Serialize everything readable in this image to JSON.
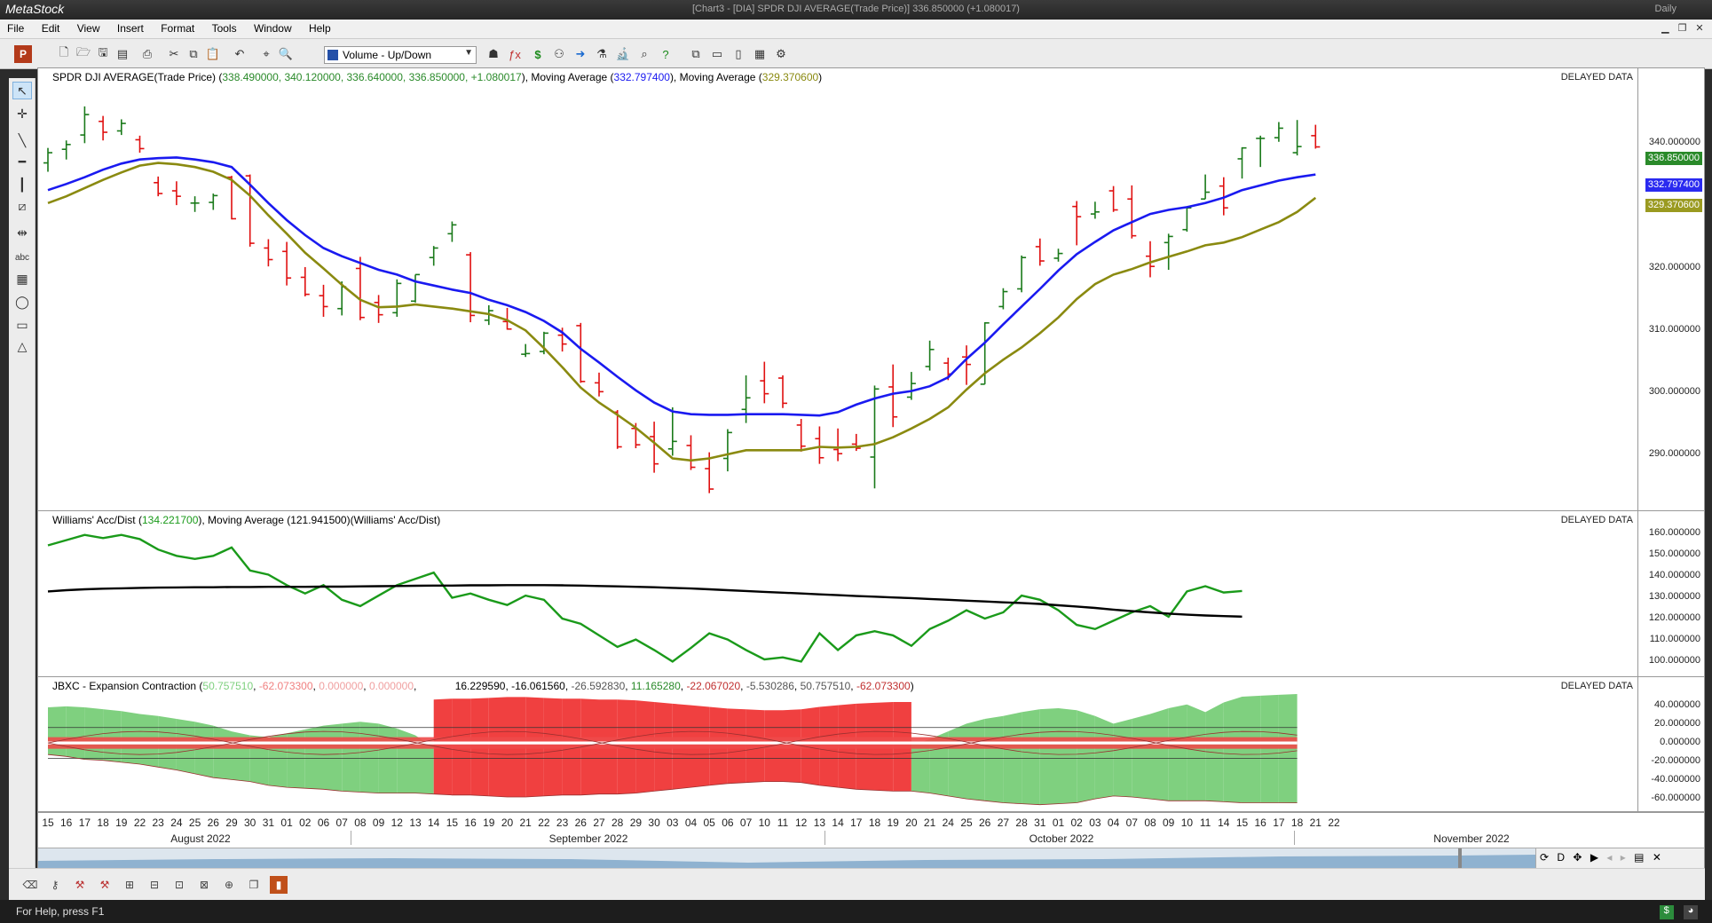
{
  "window": {
    "app_name": "MetaStock",
    "title": "[Chart3 - [DIA] SPDR DJI AVERAGE(Trade Price)]  336.850000 (+1.080017)",
    "periodicity": "Daily"
  },
  "menu": [
    "File",
    "Edit",
    "View",
    "Insert",
    "Format",
    "Tools",
    "Window",
    "Help"
  ],
  "toolbar": {
    "chart_style_select": "Volume - Up/Down"
  },
  "colors": {
    "up_bar": "#1a7a1a",
    "down_bar": "#e01010",
    "ma_fast": "#1a1af0",
    "ma_slow": "#8a8a10",
    "wad_line": "#1a9a1a",
    "wad_ma": "#000000",
    "expansion_fill": "#7fd07f",
    "contraction_fill": "#f04040"
  },
  "price_pane": {
    "title_prefix": "SPDR DJI AVERAGE(Trade Price) (",
    "ohlc": "338.490000, 340.120000, 336.640000, 336.850000, +1.080017",
    "title_mid1": "), Moving Average (",
    "ma1": "332.797400",
    "title_mid2": "), Moving Average (",
    "ma2": "329.370600",
    "title_suffix": ")",
    "delayed": "DELAYED DATA",
    "yticks": [
      "340.000000",
      "320.000000",
      "310.000000",
      "300.000000",
      "290.000000"
    ],
    "badge_close": "336.850000",
    "badge_ma1": "332.797400",
    "badge_ma2": "329.370600"
  },
  "wad_pane": {
    "title_prefix": "Williams' Acc/Dist (",
    "value": "134.221700",
    "title_mid": "), Moving Average (",
    "ma_value": "121.941500",
    "title_suffix": ")(Williams' Acc/Dist)",
    "delayed": "DELAYED DATA",
    "yticks": [
      "160.000000",
      "150.000000",
      "140.000000",
      "130.000000",
      "120.000000",
      "110.000000",
      "100.000000"
    ]
  },
  "jbxc_pane": {
    "title_prefix": "JBXC - Expansion Contraction (",
    "v1": "50.757510",
    "v2": "-62.073300",
    "v3": "0.000000",
    "v4": "0.000000",
    "v5": "16.229590",
    "v6": "-16.061560",
    "v7": "-26.592830",
    "v8": "11.165280",
    "v9": "-22.067020",
    "v10": "-5.530286",
    "v11": "50.757510",
    "v12": "-62.073300",
    "title_suffix": ")",
    "delayed": "DELAYED DATA",
    "yticks": [
      "40.000000",
      "20.000000",
      "0.000000",
      "-20.000000",
      "-40.000000",
      "-60.000000"
    ]
  },
  "xaxis": {
    "days": [
      "15",
      "16",
      "17",
      "18",
      "19",
      "22",
      "23",
      "24",
      "25",
      "26",
      "29",
      "30",
      "31",
      "01",
      "02",
      "06",
      "07",
      "08",
      "09",
      "12",
      "13",
      "14",
      "15",
      "16",
      "19",
      "20",
      "21",
      "22",
      "23",
      "26",
      "27",
      "28",
      "29",
      "30",
      "03",
      "04",
      "05",
      "06",
      "07",
      "10",
      "11",
      "12",
      "13",
      "14",
      "17",
      "18",
      "19",
      "20",
      "21",
      "24",
      "25",
      "26",
      "27",
      "28",
      "31",
      "01",
      "02",
      "03",
      "04",
      "07",
      "08",
      "09",
      "10",
      "11",
      "14",
      "15",
      "16",
      "17",
      "18",
      "21",
      "22"
    ],
    "months": [
      "August 2022",
      "September 2022",
      "October 2022",
      "November 2022"
    ]
  },
  "overview": {
    "periodicity_letter": "D"
  },
  "status": {
    "help": "For Help, press F1"
  },
  "chart_data": [
    {
      "type": "ohlc",
      "title": "SPDR DJI AVERAGE(Trade Price)",
      "ylim": [
        284,
        345
      ],
      "bars": [
        [
          334.5,
          336.7,
          333.2,
          336.0
        ],
        [
          336.5,
          337.8,
          335.0,
          337.2
        ],
        [
          338.6,
          342.8,
          337.4,
          341.6
        ],
        [
          340.6,
          341.4,
          337.8,
          339.0
        ],
        [
          339.2,
          340.9,
          338.6,
          340.3
        ],
        [
          337.9,
          338.5,
          336.0,
          336.6
        ],
        [
          331.6,
          332.5,
          329.6,
          330.0
        ],
        [
          330.4,
          331.8,
          328.3,
          329.6
        ],
        [
          328.6,
          329.6,
          327.3,
          328.6
        ],
        [
          328.7,
          330.0,
          327.6,
          329.7
        ],
        [
          332.4,
          332.6,
          326.2,
          326.3
        ],
        [
          332.6,
          332.8,
          322.2,
          322.7
        ],
        [
          322.0,
          323.3,
          319.3,
          320.3
        ],
        [
          321.5,
          322.9,
          316.5,
          317.6
        ],
        [
          317.7,
          319.2,
          314.9,
          315.2
        ],
        [
          315.0,
          316.6,
          311.9,
          313.4
        ],
        [
          313.1,
          317.1,
          312.1,
          316.3
        ],
        [
          319.0,
          320.7,
          311.4,
          311.8
        ],
        [
          314.0,
          315.1,
          311.0,
          312.2
        ],
        [
          312.5,
          317.4,
          311.9,
          316.8
        ],
        [
          314.2,
          318.1,
          314.0,
          318.1
        ],
        [
          320.6,
          322.3,
          319.4,
          322.0
        ],
        [
          324.1,
          325.9,
          322.9,
          325.4
        ],
        [
          321.0,
          321.4,
          311.1,
          312.1
        ],
        [
          311.4,
          313.6,
          310.7,
          312.8
        ],
        [
          311.2,
          313.2,
          310.0,
          310.1
        ],
        [
          306.4,
          307.9,
          306.0,
          306.5
        ],
        [
          306.8,
          309.7,
          306.4,
          309.5
        ],
        [
          309.2,
          310.3,
          306.8,
          307.9
        ],
        [
          310.6,
          311.0,
          302.2,
          302.4
        ],
        [
          302.2,
          303.7,
          300.2,
          300.9
        ],
        [
          297.9,
          298.2,
          292.5,
          292.8
        ],
        [
          295.5,
          296.3,
          292.6,
          293.1
        ],
        [
          294.3,
          296.5,
          289.0,
          290.3
        ],
        [
          292.5,
          298.6,
          291.5,
          293.6
        ],
        [
          293.0,
          294.5,
          289.4,
          289.8
        ],
        [
          289.6,
          292.0,
          286.0,
          286.6
        ],
        [
          291.1,
          295.4,
          289.2,
          294.9
        ],
        [
          298.3,
          303.3,
          296.3,
          300.0
        ],
        [
          302.5,
          305.3,
          299.2,
          300.6
        ],
        [
          302.9,
          303.3,
          298.5,
          299.2
        ],
        [
          296.0,
          296.9,
          292.1,
          292.9
        ],
        [
          294.0,
          295.8,
          290.3,
          291.2
        ],
        [
          292.4,
          295.5,
          290.7,
          291.8
        ],
        [
          293.2,
          294.7,
          292.2,
          292.6
        ],
        [
          291.3,
          301.8,
          286.7,
          301.3
        ],
        [
          301.6,
          304.9,
          295.7,
          297.2
        ],
        [
          300.1,
          303.8,
          299.7,
          302.1
        ],
        [
          304.6,
          308.4,
          304.0,
          307.1
        ],
        [
          305.1,
          305.9,
          302.6,
          303.5
        ],
        [
          306.0,
          307.7,
          301.9,
          304.9
        ],
        [
          302.0,
          311.1,
          302.0,
          311.0
        ],
        [
          313.4,
          316.1,
          313.0,
          315.6
        ],
        [
          316.0,
          320.9,
          315.5,
          320.6
        ],
        [
          322.2,
          323.4,
          319.4,
          320.1
        ],
        [
          320.5,
          321.9,
          320.0,
          321.2
        ],
        [
          328.1,
          328.9,
          322.4,
          326.6
        ],
        [
          327.0,
          328.8,
          326.3,
          327.3
        ],
        [
          330.4,
          331.1,
          327.3,
          327.6
        ],
        [
          329.2,
          331.2,
          323.4,
          323.8
        ],
        [
          320.8,
          323.0,
          317.7,
          319.3
        ],
        [
          322.8,
          324.1,
          318.8,
          323.7
        ],
        [
          324.7,
          328.1,
          324.4,
          327.9
        ],
        [
          329.2,
          332.8,
          329.2,
          330.2
        ],
        [
          331.1,
          332.4,
          326.8,
          327.9
        ],
        [
          335.1,
          336.8,
          332.2,
          336.7
        ],
        [
          338.1,
          338.5,
          333.9,
          338.1
        ],
        [
          338.2,
          340.5,
          337.6,
          339.6
        ],
        [
          336.0,
          340.8,
          335.6,
          336.9
        ],
        [
          338.5,
          340.1,
          336.6,
          336.85
        ]
      ],
      "ma1": [
        330.5,
        331.4,
        332.4,
        333.5,
        334.4,
        335.0,
        335.2,
        335.3,
        335.0,
        334.6,
        333.9,
        331.3,
        328.6,
        326.1,
        323.9,
        322.0,
        320.8,
        319.8,
        318.8,
        318.1,
        317.1,
        316.5,
        315.9,
        315.4,
        314.4,
        313.6,
        312.6,
        311.3,
        309.6,
        307.2,
        305.2,
        303.1,
        301.1,
        299.3,
        298.0,
        297.6,
        297.5,
        297.5,
        297.6,
        297.6,
        297.6,
        297.5,
        297.4,
        297.9,
        299.0,
        299.9,
        300.6,
        301.0,
        301.7,
        303.0,
        305.7,
        308.1,
        310.8,
        313.4,
        316.0,
        318.7,
        321.1,
        322.9,
        324.6,
        325.8,
        327.0,
        327.6,
        328.0,
        328.6,
        329.4,
        330.5,
        331.2,
        331.9,
        332.4,
        332.797
      ],
      "ma2": [
        328.6,
        329.6,
        330.8,
        332.0,
        333.1,
        334.1,
        334.5,
        334.3,
        333.9,
        333.2,
        332.0,
        329.7,
        326.8,
        324.1,
        321.3,
        319.0,
        316.6,
        314.4,
        313.3,
        313.4,
        313.7,
        313.4,
        313.1,
        312.7,
        312.3,
        311.4,
        309.9,
        307.3,
        304.5,
        301.5,
        299.3,
        297.5,
        295.6,
        293.4,
        291.1,
        290.8,
        291.1,
        291.7,
        292.3,
        292.3,
        292.3,
        292.3,
        292.8,
        292.7,
        292.8,
        293.2,
        294.2,
        295.5,
        296.9,
        298.6,
        301.2,
        303.6,
        305.6,
        307.4,
        309.5,
        311.8,
        314.5,
        316.7,
        318.1,
        318.9,
        319.9,
        320.7,
        321.5,
        322.4,
        322.8,
        323.6,
        324.7,
        325.8,
        327.3,
        329.3706
      ]
    },
    {
      "type": "line",
      "title": "Williams' Acc/Dist",
      "ylim": [
        96,
        163
      ],
      "series": [
        {
          "name": "Williams' Acc/Dist",
          "values": [
            156,
            158.5,
            161,
            159.5,
            161,
            159,
            154,
            151,
            149.5,
            151,
            155,
            144,
            142,
            137,
            133,
            137,
            130,
            127,
            132,
            137,
            140,
            143,
            131,
            133,
            130,
            127.5,
            132,
            130,
            121,
            118.5,
            113,
            107.5,
            111,
            106,
            100.5,
            107,
            114,
            111,
            106,
            101.5,
            102.5,
            100.5,
            114,
            106,
            113,
            115,
            113,
            108,
            116,
            120,
            125,
            121,
            124,
            132,
            130,
            125,
            118,
            116,
            120,
            124,
            127,
            121.9,
            134,
            136.5,
            133.5,
            134.2217
          ]
        },
        {
          "name": "Moving Average",
          "values": [
            134,
            134.6,
            135,
            135.3,
            135.5,
            135.7,
            135.8,
            135.9,
            136,
            136,
            136.1,
            136.1,
            136.2,
            136.2,
            136.2,
            136.3,
            136.3,
            136.4,
            136.5,
            136.6,
            136.7,
            136.8,
            136.8,
            136.9,
            136.9,
            137,
            137,
            137,
            136.9,
            136.8,
            136.6,
            136.4,
            136.2,
            136,
            135.7,
            135.4,
            135,
            134.6,
            134.2,
            133.8,
            133.4,
            133,
            132.6,
            132.2,
            131.8,
            131.5,
            131.1,
            130.8,
            130.4,
            130,
            129.6,
            129.2,
            128.8,
            128.5,
            128,
            127.4,
            126.8,
            126.1,
            125.3,
            124.6,
            124,
            123.4,
            122.9,
            122.5,
            122.2,
            121.9415
          ]
        }
      ]
    },
    {
      "type": "area",
      "title": "JBXC - Expansion Contraction",
      "ylim": [
        -68,
        48
      ],
      "series": [
        {
          "name": "upper_envelope",
          "values": [
            37,
            38,
            37,
            35,
            33,
            30,
            28,
            25,
            22,
            18,
            12,
            8,
            6,
            10,
            14,
            18,
            20,
            22,
            20,
            15,
            8,
            -5,
            -10,
            -12,
            -12,
            -10,
            -8,
            -5,
            -3,
            -4,
            -6,
            -8,
            -12,
            -15,
            -17,
            -13,
            -10,
            -8,
            -6,
            -5,
            -3,
            -4,
            -8,
            -12,
            -14,
            -10,
            -6,
            -3,
            4,
            12,
            20,
            25,
            28,
            32,
            35,
            36,
            34,
            28,
            20,
            25,
            30,
            36,
            40,
            32,
            42,
            48,
            49,
            50,
            50.75751
          ]
        },
        {
          "name": "lower_envelope",
          "values": [
            -12,
            -14,
            -17,
            -18,
            -20,
            -22,
            -25,
            -28,
            -32,
            -36,
            -38,
            -40,
            -44,
            -46,
            -47,
            -48,
            -50,
            -51,
            -52,
            -52,
            -52,
            -53,
            -54,
            -54,
            -55,
            -56,
            -56,
            -55,
            -54,
            -54,
            -53,
            -53,
            -52,
            -50,
            -48,
            -46,
            -44,
            -42,
            -41,
            -40,
            -40,
            -41,
            -44,
            -46,
            -48,
            -49,
            -50,
            -50,
            -52,
            -55,
            -58,
            -60,
            -62,
            -63,
            -64,
            -63,
            -62,
            -58,
            -55,
            -56,
            -58,
            -60,
            -60,
            -60,
            -61,
            -62,
            -62,
            -62,
            -62.0733
          ]
        }
      ]
    }
  ]
}
